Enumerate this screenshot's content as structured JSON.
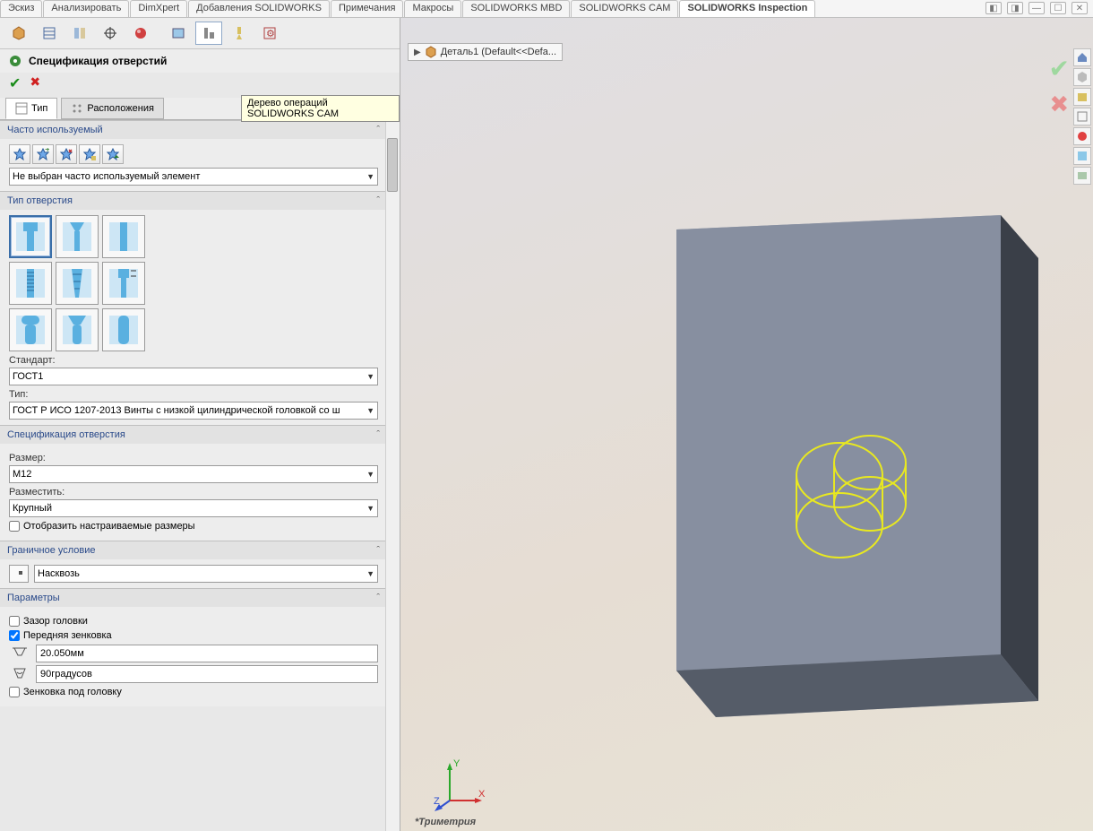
{
  "tabs": {
    "items": [
      "Эскиз",
      "Анализировать",
      "DimXpert",
      "Добавления SOLIDWORKS",
      "Примечания",
      "Макросы",
      "SOLIDWORKS MBD",
      "SOLIDWORKS CAM",
      "SOLIDWORKS Inspection"
    ],
    "active": 8
  },
  "tooltip": "Дерево операций SOLIDWORKS CAM",
  "pm": {
    "title": "Спецификация отверстий",
    "tab1": "Тип",
    "tab2": "Расположения"
  },
  "fav": {
    "header": "Часто используемый",
    "combo": "Не выбран часто используемый элемент"
  },
  "holetype": {
    "header": "Тип отверстия",
    "std_label": "Стандарт:",
    "std": "ГОСТ1",
    "type_label": "Тип:",
    "type": "ГОСТ Р ИСО 1207-2013 Винты с низкой цилиндрической головкой со ш"
  },
  "holespec": {
    "header": "Спецификация отверстия",
    "size_label": "Размер:",
    "size": "М12",
    "fit_label": "Разместить:",
    "fit": "Крупный",
    "custom": "Отобразить настраиваемые размеры"
  },
  "endcond": {
    "header": "Граничное условие",
    "value": "Насквозь"
  },
  "options": {
    "header": "Параметры",
    "head_clear": "Зазор головки",
    "near_csk": "Передняя зенковка",
    "dia": "20.050мм",
    "ang": "90градусов",
    "under_csk": "Зенковка под головку"
  },
  "part": {
    "tab": "Деталь1  (Default<<Defa..."
  },
  "viewname": "*Триметрия"
}
